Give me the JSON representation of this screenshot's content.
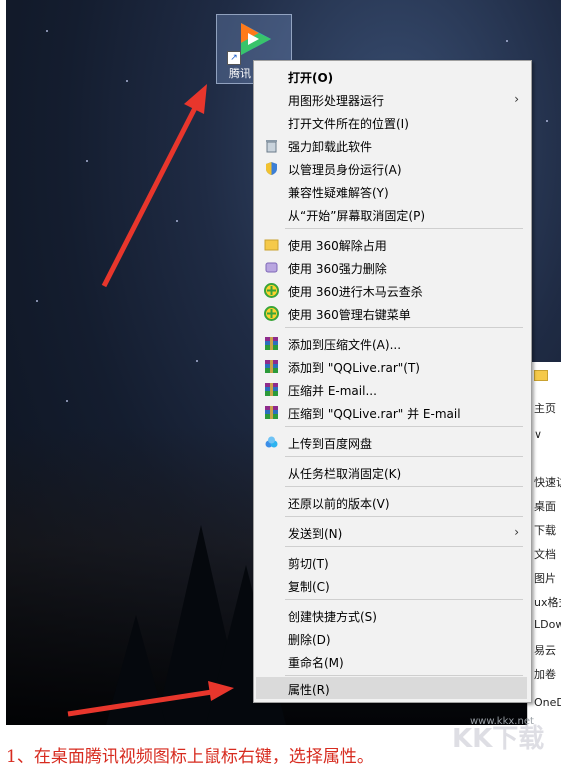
{
  "desktop": {
    "icon_label": "腾讯"
  },
  "context_menu": {
    "items": [
      {
        "label": "打开(O)",
        "icon": "none",
        "bold": true
      },
      {
        "label": "用图形处理器运行",
        "icon": "none",
        "submenu": true
      },
      {
        "label": "打开文件所在的位置(I)",
        "icon": "none"
      },
      {
        "label": "强力卸载此软件",
        "icon": "trash-icon"
      },
      {
        "label": "以管理员身份运行(A)",
        "icon": "shield-icon"
      },
      {
        "label": "兼容性疑难解答(Y)",
        "icon": "none"
      },
      {
        "label": "从“开始”屏幕取消固定(P)",
        "icon": "none"
      },
      {
        "label": "使用 360解除占用",
        "icon": "folder-icon"
      },
      {
        "label": "使用 360强力删除",
        "icon": "shredder-icon"
      },
      {
        "label": "使用 360进行木马云查杀",
        "icon": "360-icon"
      },
      {
        "label": "使用 360管理右键菜单",
        "icon": "360-icon"
      },
      {
        "label": "添加到压缩文件(A)...",
        "icon": "winrar-icon"
      },
      {
        "label": "添加到 \"QQLive.rar\"(T)",
        "icon": "winrar-icon"
      },
      {
        "label": "压缩并 E-mail...",
        "icon": "winrar-icon"
      },
      {
        "label": "压缩到 \"QQLive.rar\" 并 E-mail",
        "icon": "winrar-icon"
      },
      {
        "label": "上传到百度网盘",
        "icon": "baidu-cloud-icon"
      },
      {
        "label": "从任务栏取消固定(K)",
        "icon": "none"
      },
      {
        "label": "还原以前的版本(V)",
        "icon": "none"
      },
      {
        "label": "发送到(N)",
        "icon": "none",
        "submenu": true
      },
      {
        "label": "剪切(T)",
        "icon": "none"
      },
      {
        "label": "复制(C)",
        "icon": "none"
      },
      {
        "label": "创建快捷方式(S)",
        "icon": "none"
      },
      {
        "label": "删除(D)",
        "icon": "none"
      },
      {
        "label": "重命名(M)",
        "icon": "none"
      },
      {
        "label": "属性(R)",
        "icon": "none",
        "highlighted": true
      }
    ]
  },
  "explorer_partial": {
    "rows": [
      "主页",
      "∨",
      "快速访问",
      "桌面",
      "下载",
      "文档",
      "图片",
      "ux格式",
      "LDow",
      "易云",
      "加卷",
      "OneDriv"
    ]
  },
  "caption": "1、在桌面腾讯视频图标上鼠标右键，选择属性。",
  "watermark": {
    "small": "www.kkx.net",
    "big": "KK下载"
  },
  "colors": {
    "annotation_red": "#e8362c",
    "caption_red": "#d72b1f",
    "menu_bg": "#f2f2f2",
    "highlight": "#dadada"
  }
}
